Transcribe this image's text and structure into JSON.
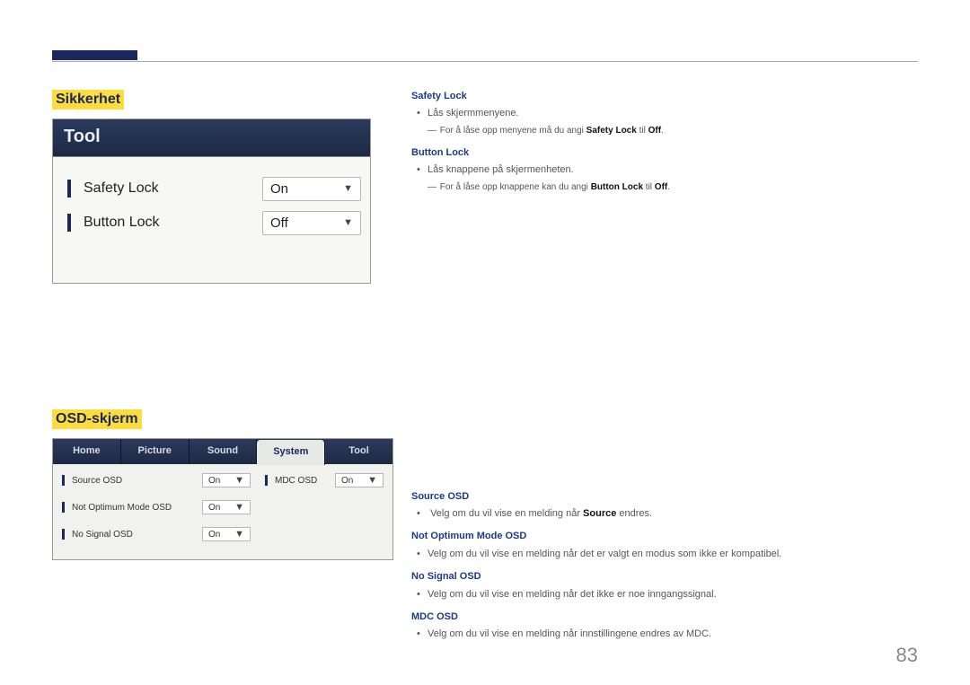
{
  "page_number": "83",
  "section1": {
    "heading": "Sikkerhet",
    "tool_title": "Tool",
    "rows": [
      {
        "label": "Safety Lock",
        "value": "On"
      },
      {
        "label": "Button Lock",
        "value": "Off"
      }
    ],
    "rc": {
      "safety_lock_h": "Safety Lock",
      "safety_lock_b1": "Lås skjermmenyene.",
      "safety_lock_note_pre": "For å låse opp menyene må du angi ",
      "safety_lock_note_kw1": "Safety Lock",
      "safety_lock_note_mid": " til ",
      "safety_lock_note_kw2": "Off",
      "safety_lock_note_post": ".",
      "button_lock_h": "Button Lock",
      "button_lock_b1": "Lås knappene på skjermenheten.",
      "button_lock_note_pre": "For å låse opp knappene kan du angi ",
      "button_lock_note_kw1": "Button Lock",
      "button_lock_note_mid": " til ",
      "button_lock_note_kw2": "Off",
      "button_lock_note_post": "."
    }
  },
  "section2": {
    "heading": "OSD-skjerm",
    "tabs": [
      "Home",
      "Picture",
      "Sound",
      "System",
      "Tool"
    ],
    "active_tab_index": 3,
    "left_rows": [
      {
        "label": "Source OSD",
        "value": "On"
      },
      {
        "label": "Not Optimum Mode OSD",
        "value": "On"
      },
      {
        "label": "No Signal OSD",
        "value": "On"
      }
    ],
    "right_rows": [
      {
        "label": "MDC OSD",
        "value": "On"
      }
    ],
    "rc": {
      "source_h": "Source OSD",
      "source_b_pre": "Velg om du vil vise en melding når ",
      "source_b_kw": "Source",
      "source_b_post": " endres.",
      "notopt_h": "Not Optimum Mode OSD",
      "notopt_b": "Velg om du vil vise en melding når det er valgt en modus som ikke er kompatibel.",
      "nosig_h": "No Signal OSD",
      "nosig_b": "Velg om du vil vise en melding når det ikke er noe inngangssignal.",
      "mdc_h": "MDC OSD",
      "mdc_b": "Velg om du vil vise en melding når innstillingene endres av MDC."
    }
  }
}
